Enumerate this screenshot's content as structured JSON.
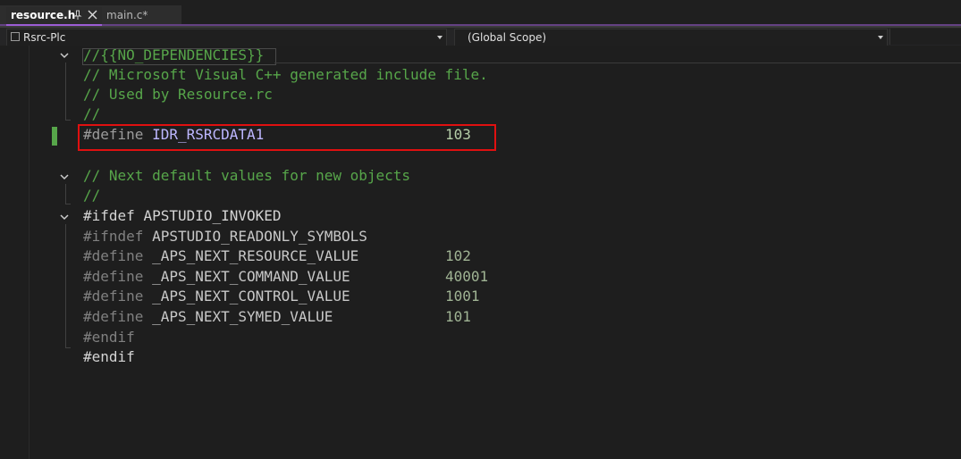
{
  "tabs": [
    {
      "label": "resource.h",
      "active": true
    },
    {
      "label": "main.c*",
      "active": false
    }
  ],
  "navbar": {
    "project": "Rsrc-Plc",
    "scope": "(Global Scope)"
  },
  "code": {
    "line1": "//{{NO_DEPENDENCIES}}",
    "line2": "// Microsoft Visual C++ generated include file.",
    "line3": "// Used by Resource.rc",
    "line4": "//",
    "line5_kw": "#define",
    "line5_name": "IDR_RSRCDATA1",
    "line5_val": "103",
    "line7": "// Next default values for new objects",
    "line8": "//",
    "line9_kw": "#ifdef",
    "line9_name": "APSTUDIO_INVOKED",
    "line10_kw": "#ifndef",
    "line10_name": "APSTUDIO_READONLY_SYMBOLS",
    "line11_kw": "#define",
    "line11_name": "_APS_NEXT_RESOURCE_VALUE",
    "line11_val": "102",
    "line12_kw": "#define",
    "line12_name": "_APS_NEXT_COMMAND_VALUE",
    "line12_val": "40001",
    "line13_kw": "#define",
    "line13_name": "_APS_NEXT_CONTROL_VALUE",
    "line13_val": "1001",
    "line14_kw": "#define",
    "line14_name": "_APS_NEXT_SYMED_VALUE",
    "line14_val": "101",
    "line15": "#endif",
    "line16": "#endif"
  },
  "colors": {
    "comment": "#57a64a",
    "macro": "#bdb7ff",
    "number": "#b5cea8",
    "accent": "#9d5dd6",
    "highlight": "#e01010"
  }
}
